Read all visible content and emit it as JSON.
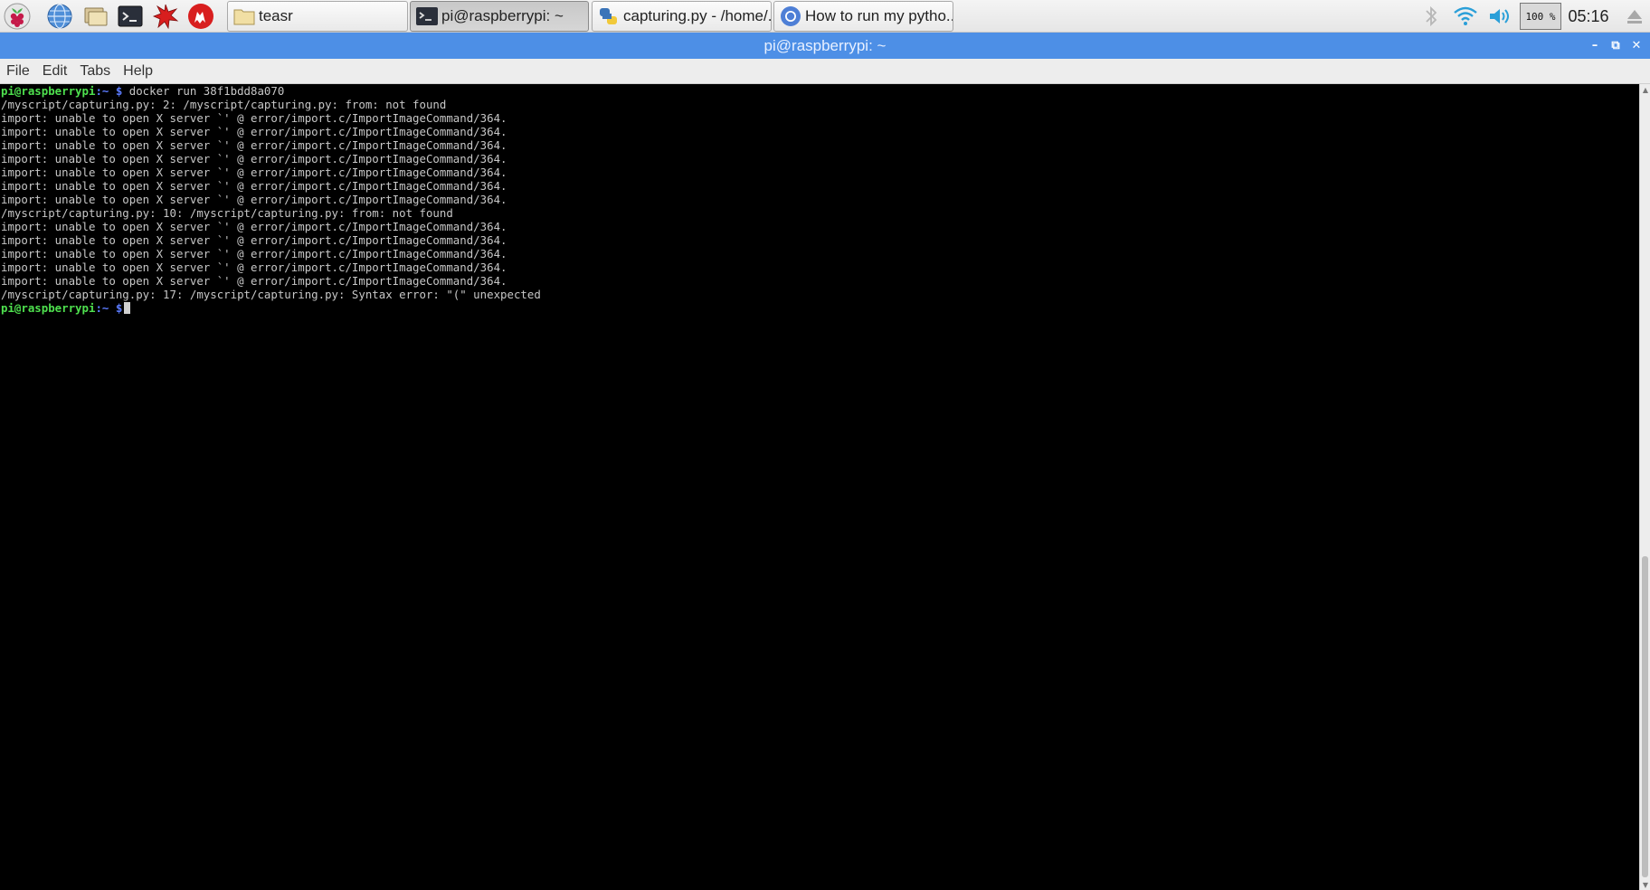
{
  "taskbar": {
    "launchers": [
      {
        "name": "menu",
        "icon": "raspberry-pi-logo-icon"
      },
      {
        "name": "web-browser",
        "icon": "globe-icon"
      },
      {
        "name": "file-manager",
        "icon": "folders-icon"
      },
      {
        "name": "terminal",
        "icon": "terminal-icon"
      },
      {
        "name": "mathematica",
        "icon": "mathematica-star-icon"
      },
      {
        "name": "wolfram",
        "icon": "wolf-icon"
      }
    ],
    "windows": [
      {
        "label": "teasr",
        "icon": "folder-icon",
        "active": false
      },
      {
        "label": "pi@raspberrypi: ~",
        "icon": "terminal-icon",
        "active": true
      },
      {
        "label": "capturing.py - /home/...",
        "icon": "python-icon",
        "active": false
      },
      {
        "label": "How to run my pytho...",
        "icon": "chromium-icon",
        "active": false
      }
    ],
    "tray": {
      "bluetooth_icon": "bluetooth-icon",
      "wifi_icon": "wifi-icon",
      "volume_icon": "volume-icon",
      "battery_text": "100 %",
      "clock": "05:16",
      "eject_icon": "eject-icon"
    }
  },
  "window": {
    "title": "pi@raspberrypi: ~",
    "controls": {
      "minimize": "–",
      "maximize": "⧉",
      "close": "✕"
    },
    "menu": [
      "File",
      "Edit",
      "Tabs",
      "Help"
    ]
  },
  "terminal": {
    "prompt": {
      "user": "pi@raspberrypi",
      "path": ":~",
      "sign": " $"
    },
    "command": " docker run 38f1bdd8a070",
    "output": [
      "/myscript/capturing.py: 2: /myscript/capturing.py: from: not found",
      "import: unable to open X server `' @ error/import.c/ImportImageCommand/364.",
      "import: unable to open X server `' @ error/import.c/ImportImageCommand/364.",
      "import: unable to open X server `' @ error/import.c/ImportImageCommand/364.",
      "import: unable to open X server `' @ error/import.c/ImportImageCommand/364.",
      "import: unable to open X server `' @ error/import.c/ImportImageCommand/364.",
      "import: unable to open X server `' @ error/import.c/ImportImageCommand/364.",
      "import: unable to open X server `' @ error/import.c/ImportImageCommand/364.",
      "/myscript/capturing.py: 10: /myscript/capturing.py: from: not found",
      "import: unable to open X server `' @ error/import.c/ImportImageCommand/364.",
      "import: unable to open X server `' @ error/import.c/ImportImageCommand/364.",
      "import: unable to open X server `' @ error/import.c/ImportImageCommand/364.",
      "import: unable to open X server `' @ error/import.c/ImportImageCommand/364.",
      "import: unable to open X server `' @ error/import.c/ImportImageCommand/364.",
      "/myscript/capturing.py: 17: /myscript/capturing.py: Syntax error: \"(\" unexpected"
    ]
  },
  "colors": {
    "titlebar": "#4d8fe6",
    "prompt_user": "#4ee04e",
    "prompt_path": "#5c7cff",
    "terminal_bg": "#000000",
    "terminal_fg": "#c7c7c7"
  }
}
